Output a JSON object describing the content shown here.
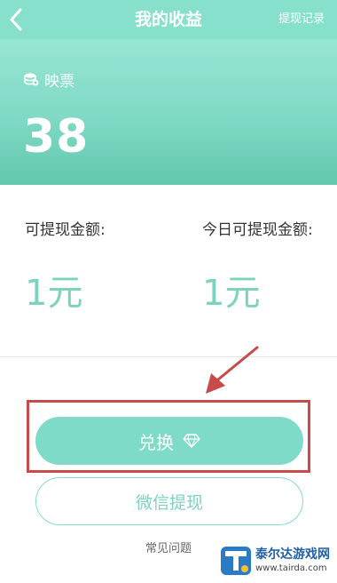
{
  "header": {
    "title": "我的收益",
    "right_link": "提现记录"
  },
  "card": {
    "label": "映票",
    "value": "38"
  },
  "withdrawable": {
    "label": "可提现金额:",
    "value": "1元"
  },
  "today_withdrawable": {
    "label": "今日可提现金额:",
    "value": "1元"
  },
  "buttons": {
    "exchange": "兑换",
    "wechat_withdraw": "微信提现"
  },
  "faq": "常见问题",
  "watermark": {
    "name": "泰尔达游戏网",
    "url": "www.tairda.com"
  },
  "colors": {
    "accent": "#86e0cc",
    "annotation": "#c94a4a"
  }
}
